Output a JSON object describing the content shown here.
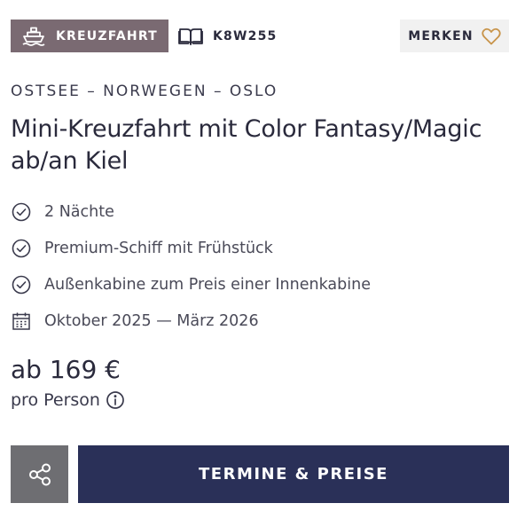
{
  "header": {
    "category_label": "KREUZFAHRT",
    "category_icon": "ship-icon",
    "code_icon": "book-icon",
    "code": "K8W255",
    "merken_label": "MERKEN",
    "merken_icon": "heart-icon"
  },
  "route": "OSTSEE – NORWEGEN – OSLO",
  "title": "Mini-Kreuzfahrt mit Color Fantasy/Magic ab/an Kiel",
  "features": [
    {
      "icon": "check-circle-icon",
      "text": "2 Nächte"
    },
    {
      "icon": "check-circle-icon",
      "text": "Premium-Schiff mit Frühstück"
    },
    {
      "icon": "check-circle-icon",
      "text": "Außenkabine zum Preis einer Innenkabine"
    },
    {
      "icon": "calendar-icon",
      "text": "Oktober 2025 — März 2026"
    }
  ],
  "price": {
    "text": "ab 169 €",
    "per_person": "pro Person",
    "info_icon": "info-icon"
  },
  "actions": {
    "share_icon": "share-icon",
    "dates_label": "TERMINE & PREISE"
  },
  "colors": {
    "badge_bg": "#7a6a72",
    "primary_button": "#2a3058",
    "share_button": "#6e6e72",
    "heart": "#c8944a",
    "text": "#2a2a3c"
  }
}
